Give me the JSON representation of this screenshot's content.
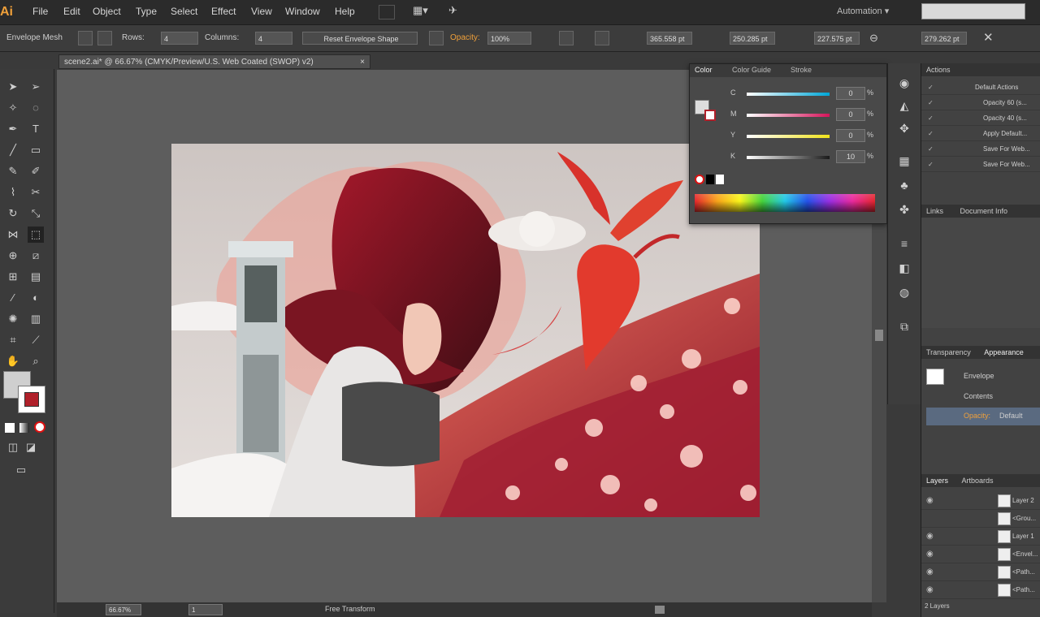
{
  "menu": {
    "logo": "Ai",
    "items": [
      "File",
      "Edit",
      "Object",
      "Type",
      "Select",
      "Effect",
      "View",
      "Window",
      "Help"
    ],
    "workspace": "Automation"
  },
  "control_bar": {
    "mode_label": "Envelope Mesh",
    "rows_label": "Rows:",
    "rows_value": "4",
    "columns_label": "Columns:",
    "columns_value": "4",
    "reset_label": "Reset Envelope Shape",
    "opacity_label": "Opacity:",
    "opacity_value": "100%",
    "x_value": "365.558 pt",
    "y_value": "250.285 pt",
    "w_value": "227.575 pt",
    "h_value": "279.262 pt"
  },
  "document_tab": {
    "title": "scene2.ai* @ 66.67% (CMYK/Preview/U.S. Web Coated (SWOP) v2)",
    "close": "×"
  },
  "color_panel": {
    "tabs": [
      "Color",
      "Color Guide",
      "Stroke"
    ],
    "channels": [
      {
        "label": "C",
        "value": "0",
        "color_start": "#ffffff",
        "color_end": "#00a6d6"
      },
      {
        "label": "M",
        "value": "0",
        "color_start": "#ffffff",
        "color_end": "#d4145a"
      },
      {
        "label": "Y",
        "value": "0",
        "color_start": "#ffffff",
        "color_end": "#f0e21a"
      },
      {
        "label": "K",
        "value": "10",
        "color_start": "#ffffff",
        "color_end": "#1a1a1a"
      }
    ],
    "unit": "%"
  },
  "actions_panel": {
    "title": "Actions",
    "items": [
      "Default Actions",
      "Opacity 60 (s...",
      "Opacity 40 (s...",
      "Apply Default...",
      "Save For Web...",
      "Save For Web..."
    ]
  },
  "links_panel": {
    "tabs": [
      "Links",
      "Document Info"
    ]
  },
  "appearance_panel": {
    "tabs": [
      "Transparency",
      "Appearance"
    ],
    "object_label": "Envelope",
    "contents_label": "Contents",
    "opacity_label": "Opacity:",
    "opacity_value": "Default"
  },
  "layers_panel": {
    "tabs": [
      "Layers",
      "Artboards"
    ],
    "rows": [
      "Layer 2",
      "<Grou...",
      "Layer 1",
      "<Envel...",
      "<Path...",
      "<Path..."
    ],
    "footer": "2 Layers"
  },
  "status": {
    "zoom": "66.67%",
    "page": "1",
    "tool": "Free Transform"
  },
  "colors": {
    "accent": "#f0a03a",
    "panel": "#494949",
    "canvas": "#5d5d5d"
  }
}
